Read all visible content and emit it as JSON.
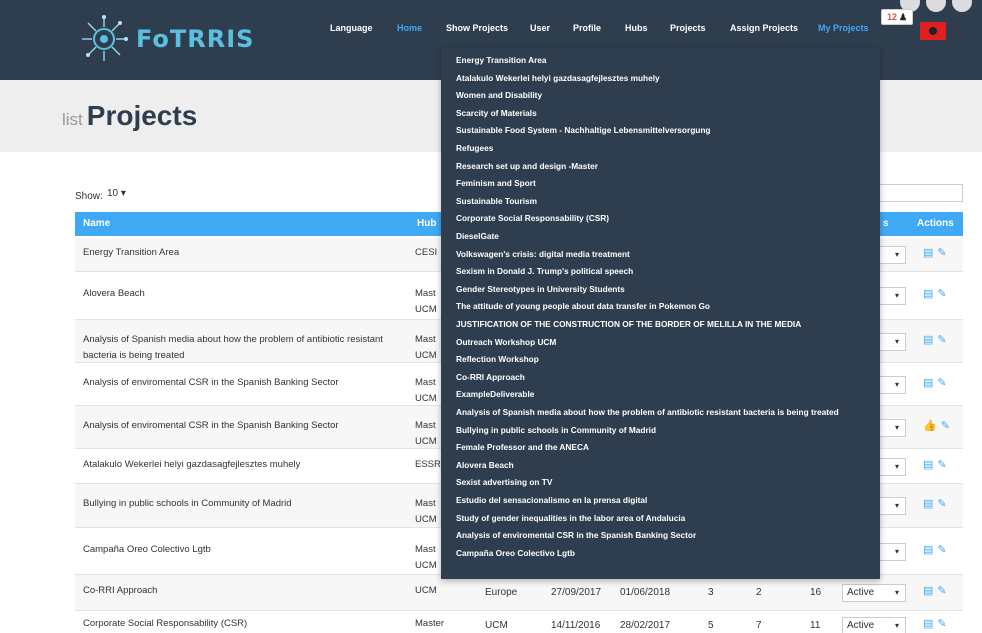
{
  "nav": {
    "logo_text": "FoTRRIS",
    "items": [
      {
        "label": "Language",
        "active": false
      },
      {
        "label": "Home",
        "active": true
      },
      {
        "label": "Show Projects",
        "active": false
      },
      {
        "label": "User",
        "active": false
      },
      {
        "label": "Profile",
        "active": false
      },
      {
        "label": "Hubs",
        "active": false
      },
      {
        "label": "Projects",
        "active": false
      },
      {
        "label": "Assign Projects",
        "active": false
      },
      {
        "label": "My Projects",
        "active": true
      }
    ],
    "badge_count": "12"
  },
  "page": {
    "title_small": "list",
    "title": "Projects",
    "show_label": "Show:",
    "show_value": "10"
  },
  "table": {
    "headers": {
      "name": "Name",
      "hub": "Hub",
      "status": "s",
      "actions": "Actions"
    },
    "rows": [
      {
        "name": "Energy Transition Area",
        "hub": "CESI",
        "status": ""
      },
      {
        "name": "Alovera Beach",
        "hub": "Mast\nUCM",
        "status": ""
      },
      {
        "name": "Analysis of Spanish media about how the problem of antibiotic resistant bacteria is being treated",
        "hub": "Mast\nUCM",
        "status": ""
      },
      {
        "name": "Analysis of enviromental CSR in the Spanish Banking Sector",
        "hub": "Mast\nUCM",
        "status": ""
      },
      {
        "name": "Analysis of enviromental CSR in the Spanish Banking Sector",
        "hub": "Mast\nUCM",
        "status": "ve"
      },
      {
        "name": "Atalakulo Wekerlei helyi gazdasagfejlesztes muhely",
        "hub": "ESSR",
        "status": ""
      },
      {
        "name": "Bullying in public schools in Community of Madrid",
        "hub": "Mast\nUCM",
        "status": ""
      },
      {
        "name": "Campaña Oreo Colectivo Lgtb",
        "hub": "Mast\nUCM",
        "status": ""
      },
      {
        "name": "Co-RRI Approach",
        "hub": "UCM",
        "status": "Active",
        "col3": "Europe",
        "start": "27/09/2017",
        "end": "01/06/2018",
        "a": "3",
        "b": "2",
        "c": "16"
      },
      {
        "name": "Corporate Social Responsability (CSR)",
        "hub": "Master",
        "status": "Active",
        "col3": "UCM",
        "start": "14/11/2016",
        "end": "28/02/2017",
        "a": "5",
        "b": "7",
        "c": "11"
      }
    ]
  },
  "dropdown": {
    "items": [
      "Energy Transition Area",
      "Atalakulo Wekerlei helyi gazdasagfejlesztes muhely",
      "Women and Disability",
      "Scarcity of Materials",
      "Sustainable Food System - Nachhaltige Lebensmittelversorgung",
      "Refugees",
      "Research set up and design -Master",
      "Feminism and Sport",
      "Sustainable Tourism",
      "Corporate Social Responsability (CSR)",
      "DieselGate",
      "Volkswagen's crisis: digital media treatment",
      "Sexism in Donald J. Trump's political speech",
      "Gender Stereotypes in University Students",
      "The attitude of young people about data transfer in Pokemon Go",
      "JUSTIFICATION OF THE CONSTRUCTION OF THE BORDER OF MELILLA IN THE MEDIA",
      "Outreach Workshop UCM",
      "Reflection Workshop",
      "Co-RRI Approach",
      "ExampleDeliverable",
      "Analysis of Spanish media about how the problem of antibiotic resistant bacteria is being treated",
      "Bullying in public schools in Community of Madrid",
      "Female Professor and the ANECA",
      "Alovera Beach",
      "Sexist advertising on TV",
      "Estudio del sensacionalismo en la prensa digital",
      "Study of gender inequalities in the labor area of Andalucia",
      "Analysis of enviromental CSR in the Spanish Banking Sector",
      "Campaña Oreo Colectivo Lgtb"
    ]
  },
  "icons": {
    "delete": "trash-icon",
    "edit": "pencil-icon",
    "like": "thumbs-up-icon",
    "user": "user-icon",
    "caret": "caret-down-icon"
  },
  "colors": {
    "navbar": "#2e3e4e",
    "accent": "#3fa9f5",
    "header_band": "#eeeeee"
  }
}
